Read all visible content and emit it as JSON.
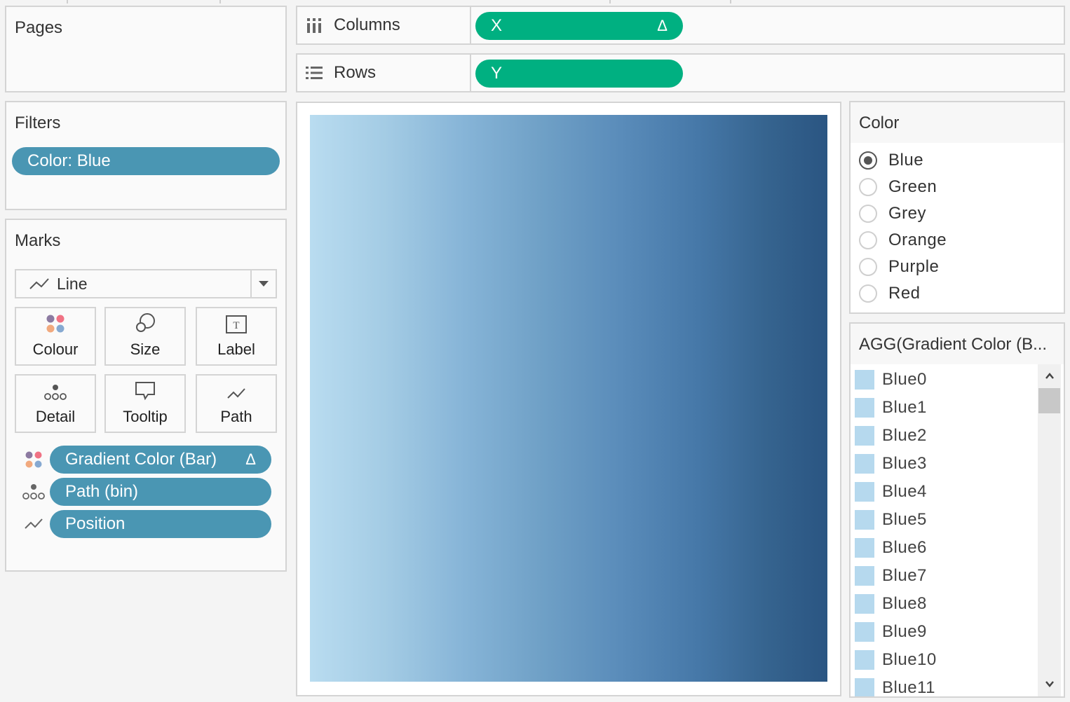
{
  "pages": {
    "title": "Pages"
  },
  "filters": {
    "title": "Filters",
    "pills": [
      {
        "label": "Color: Blue"
      }
    ]
  },
  "marks": {
    "title": "Marks",
    "mark_type": {
      "label": "Line",
      "icon": "line-chart-icon"
    },
    "cards": [
      {
        "label": "Colour",
        "icon": "colour-icon"
      },
      {
        "label": "Size",
        "icon": "size-icon"
      },
      {
        "label": "Label",
        "icon": "label-icon"
      },
      {
        "label": "Detail",
        "icon": "detail-icon"
      },
      {
        "label": "Tooltip",
        "icon": "tooltip-icon"
      },
      {
        "label": "Path",
        "icon": "path-icon"
      }
    ],
    "fields": [
      {
        "label": "Gradient Color (Bar)",
        "encoding": "colour",
        "delta": "Δ"
      },
      {
        "label": "Path (bin)",
        "encoding": "detail"
      },
      {
        "label": "Position",
        "encoding": "path"
      }
    ]
  },
  "shelves": {
    "columns": {
      "label": "Columns",
      "pill": "X",
      "delta": "Δ"
    },
    "rows": {
      "label": "Rows",
      "pill": "Y"
    }
  },
  "color_parameter": {
    "title": "Color",
    "options": [
      "Blue",
      "Green",
      "Grey",
      "Orange",
      "Purple",
      "Red"
    ],
    "selected": "Blue"
  },
  "legend": {
    "title": "AGG(Gradient Color (B...",
    "items": [
      "Blue0",
      "Blue1",
      "Blue2",
      "Blue3",
      "Blue4",
      "Blue5",
      "Blue6",
      "Blue7",
      "Blue8",
      "Blue9",
      "Blue10",
      "Blue11"
    ],
    "swatch_color": "#b6d9ee"
  },
  "colors": {
    "pill_dimension": "#4a96b3",
    "pill_continuous": "#00b081",
    "gradient_start": "#b9dcf0",
    "gradient_end": "#2a5582"
  }
}
